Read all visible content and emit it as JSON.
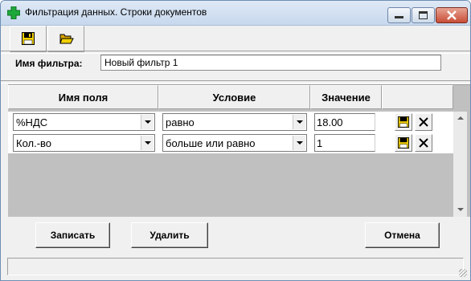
{
  "window": {
    "title": "Фильтрация данных. Строки документов"
  },
  "toolbar": {
    "save_icon": "floppy-disk-icon",
    "open_icon": "folder-open-icon"
  },
  "filter": {
    "label": "Имя фильтра:",
    "value": "Новый фильтр 1"
  },
  "grid": {
    "headers": [
      "Имя поля",
      "Условие",
      "Значение",
      ""
    ],
    "rows": [
      {
        "field": "%НДС",
        "condition": "равно",
        "value": "18.00"
      },
      {
        "field": "Кол.-во",
        "condition": "больше или равно",
        "value": "1"
      }
    ]
  },
  "buttons": {
    "save": "Записать",
    "delete": "Удалить",
    "cancel": "Отмена"
  },
  "status": ""
}
